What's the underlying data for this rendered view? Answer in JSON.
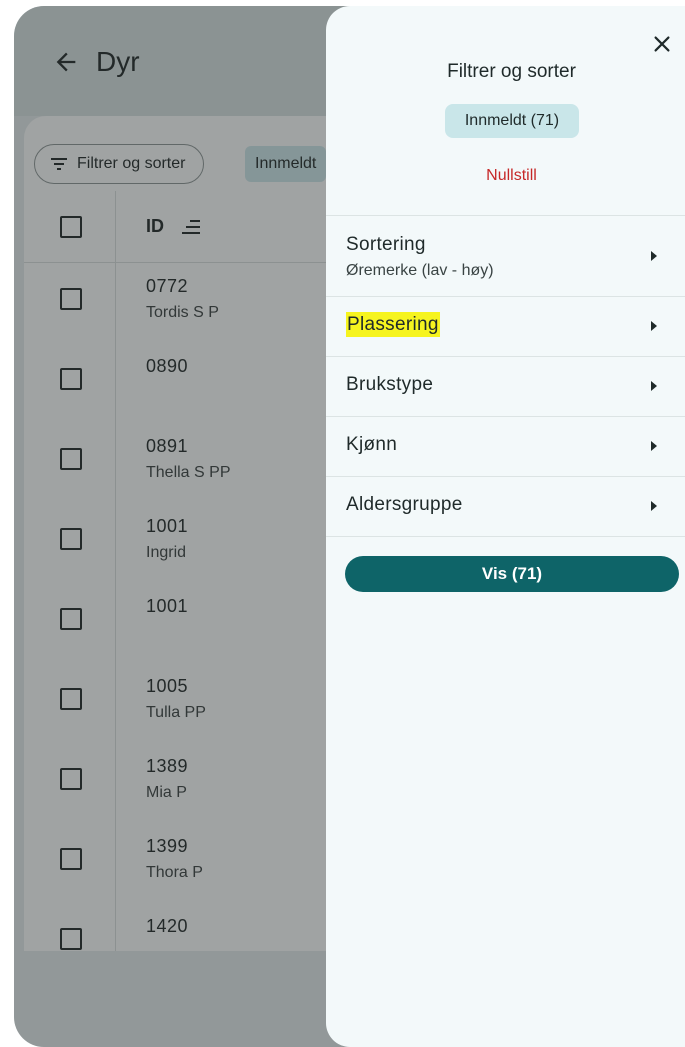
{
  "app": {
    "title": "Dyr",
    "filter_chip_label": "Filtrer og sorter",
    "status_chip_label": "Innmeldt",
    "table": {
      "id_header": "ID",
      "rows": [
        {
          "id": "0772",
          "name": "Tordis S P"
        },
        {
          "id": "0890",
          "name": ""
        },
        {
          "id": "0891",
          "name": "Thella S PP"
        },
        {
          "id": "1001",
          "name": "Ingrid"
        },
        {
          "id": "1001",
          "name": ""
        },
        {
          "id": "1005",
          "name": "Tulla PP"
        },
        {
          "id": "1389",
          "name": "Mia P"
        },
        {
          "id": "1399",
          "name": "Thora P"
        },
        {
          "id": "1420",
          "name": ""
        }
      ]
    }
  },
  "sheet": {
    "title": "Filtrer og sorter",
    "chip_label": "Innmeldt (71)",
    "reset_label": "Nullstill",
    "menu": [
      {
        "label": "Sortering",
        "sub": "Øremerke (lav - høy)",
        "highlighted": false
      },
      {
        "label": "Plassering",
        "sub": "",
        "highlighted": true
      },
      {
        "label": "Brukstype",
        "sub": "",
        "highlighted": false
      },
      {
        "label": "Kjønn",
        "sub": "",
        "highlighted": false
      },
      {
        "label": "Aldersgruppe",
        "sub": "",
        "highlighted": false
      }
    ],
    "apply_label": "Vis (71)"
  },
  "colors": {
    "accent": "#0e6468",
    "chip_bg": "#c9e6e9",
    "reset": "#c62828",
    "highlight": "#f6f41f"
  }
}
